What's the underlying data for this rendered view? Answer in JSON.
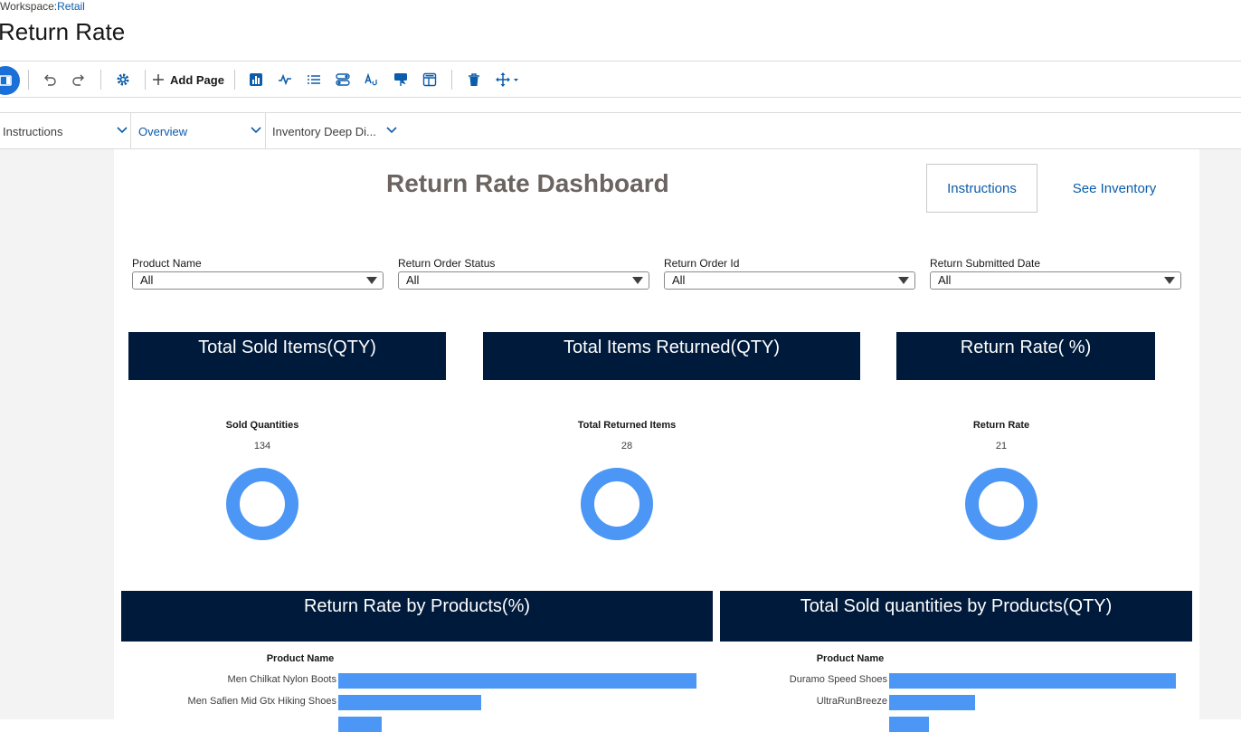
{
  "header": {
    "workspace_prefix": "Workspace:",
    "workspace_name": "Retail",
    "page_title": "Return Rate"
  },
  "toolbar": {
    "add_page_label": "Add Page"
  },
  "tabs": [
    {
      "label": "Instructions"
    },
    {
      "label": "Overview"
    },
    {
      "label": "Inventory Deep Di..."
    }
  ],
  "dashboard": {
    "title": "Return Rate Dashboard",
    "instructions_button": "Instructions",
    "see_inventory_button": "See Inventory"
  },
  "filters": [
    {
      "label": "Product Name",
      "value": "All"
    },
    {
      "label": "Return Order Status",
      "value": "All"
    },
    {
      "label": "Return Order Id",
      "value": "All"
    },
    {
      "label": "Return Submitted Date",
      "value": "All"
    }
  ],
  "section_headers": {
    "sold": "Total Sold Items(QTY)",
    "returned": "Total Items Returned(QTY)",
    "rate": "Return Rate( %)",
    "rate_by_product": "Return Rate by Products(%)",
    "sold_by_product": "Total Sold quantities by Products(QTY)"
  },
  "metrics": [
    {
      "label": "Sold Quantities",
      "value": "134"
    },
    {
      "label": "Total Returned Items",
      "value": "28"
    },
    {
      "label": "Return Rate",
      "value": "21"
    }
  ],
  "colors": {
    "accent": "#0b5cab",
    "header_bg": "#001a3b",
    "chart_blue": "#4c97f5"
  },
  "chart_data": [
    {
      "type": "bar",
      "orientation": "horizontal",
      "ylabel": "Product Name",
      "categories": [
        "Men Chilkat Nylon Boots",
        "Men Safien Mid Gtx Hiking Shoes",
        ""
      ],
      "values": [
        100,
        40,
        12
      ]
    },
    {
      "type": "bar",
      "orientation": "horizontal",
      "ylabel": "Product Name",
      "categories": [
        "Duramo Speed Shoes",
        "UltraRunBreeze",
        ""
      ],
      "values": [
        100,
        30,
        14
      ]
    }
  ]
}
